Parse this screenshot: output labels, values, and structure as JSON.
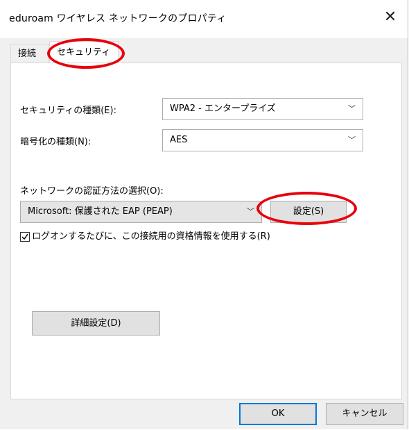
{
  "window": {
    "title": "eduroam ワイヤレス ネットワークのプロパティ",
    "close_glyph": "✕"
  },
  "tabs": [
    {
      "label": "接続",
      "selected": false
    },
    {
      "label": "セキュリティ",
      "selected": true
    }
  ],
  "security": {
    "security_type_label": "セキュリティの種類(E):",
    "security_type_value": "WPA2 - エンタープライズ",
    "encryption_label": "暗号化の種類(N):",
    "encryption_value": "AES",
    "auth_method_label": "ネットワークの認証方法の選択(O):",
    "auth_method_value": "Microsoft: 保護された EAP (PEAP)",
    "settings_button": "設定(S)",
    "remember_checkbox_label": "ログオンするたびに、この接続用の資格情報を使用する(R)",
    "remember_checked": true,
    "advanced_button": "詳細設定(D)"
  },
  "footer": {
    "ok_label": "OK",
    "cancel_label": "キャンセル"
  },
  "colors": {
    "annotation": "#e8000b",
    "default_button_border": "#0078d7"
  }
}
